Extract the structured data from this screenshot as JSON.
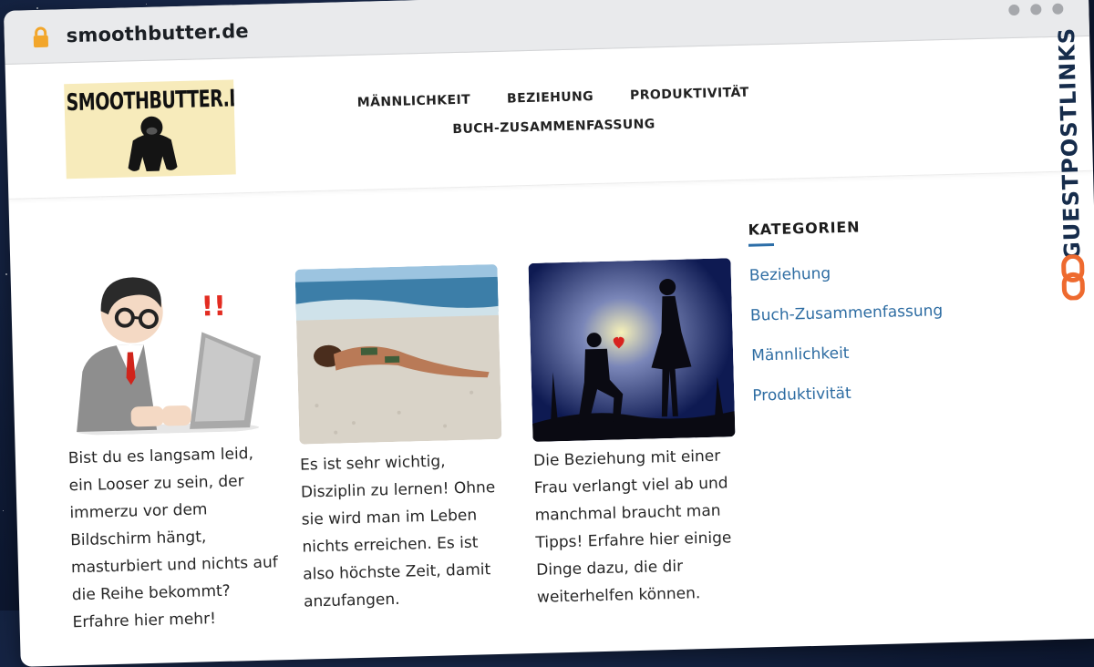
{
  "browser": {
    "url": "smoothbutter.de"
  },
  "logo": {
    "text": "SMOOTHBUTTER.DE"
  },
  "nav": {
    "items": [
      "MÄNNLICHKEIT",
      "BEZIEHUNG",
      "PRODUKTIVITÄT",
      "BUCH-ZUSAMMENFASSUNG"
    ]
  },
  "posts": [
    {
      "image_icon": "stressed-man-laptop-illustration",
      "excerpt": "Bist du es langsam leid, ein Looser zu sein, der immerzu vor dem Bildschirm hängt, masturbiert und nichts auf die Reihe bekommt? Erfahre hier mehr!"
    },
    {
      "image_icon": "woman-on-beach-photo",
      "excerpt": "Es ist sehr wichtig, Disziplin zu lernen! Ohne sie wird man im Leben nichts erreichen. Es ist also höchste Zeit, damit anzufangen."
    },
    {
      "image_icon": "proposal-silhouette-photo",
      "excerpt": "Die Beziehung mit einer Frau verlangt viel ab und manchmal braucht man Tipps! Erfahre hier einige Dinge dazu, die dir weiterhelfen können."
    }
  ],
  "sidebar": {
    "title": "KATEGORIEN",
    "links": [
      "Beziehung",
      "Buch-Zusammenfassung",
      "Männlichkeit",
      "Produktivität"
    ]
  },
  "brand": {
    "text": "GUESTPOSTLINKS",
    "color": "#162c4b",
    "accent": "#ee6a2f"
  },
  "colors": {
    "link": "#2d6ca2",
    "background": "#0f1b36"
  }
}
